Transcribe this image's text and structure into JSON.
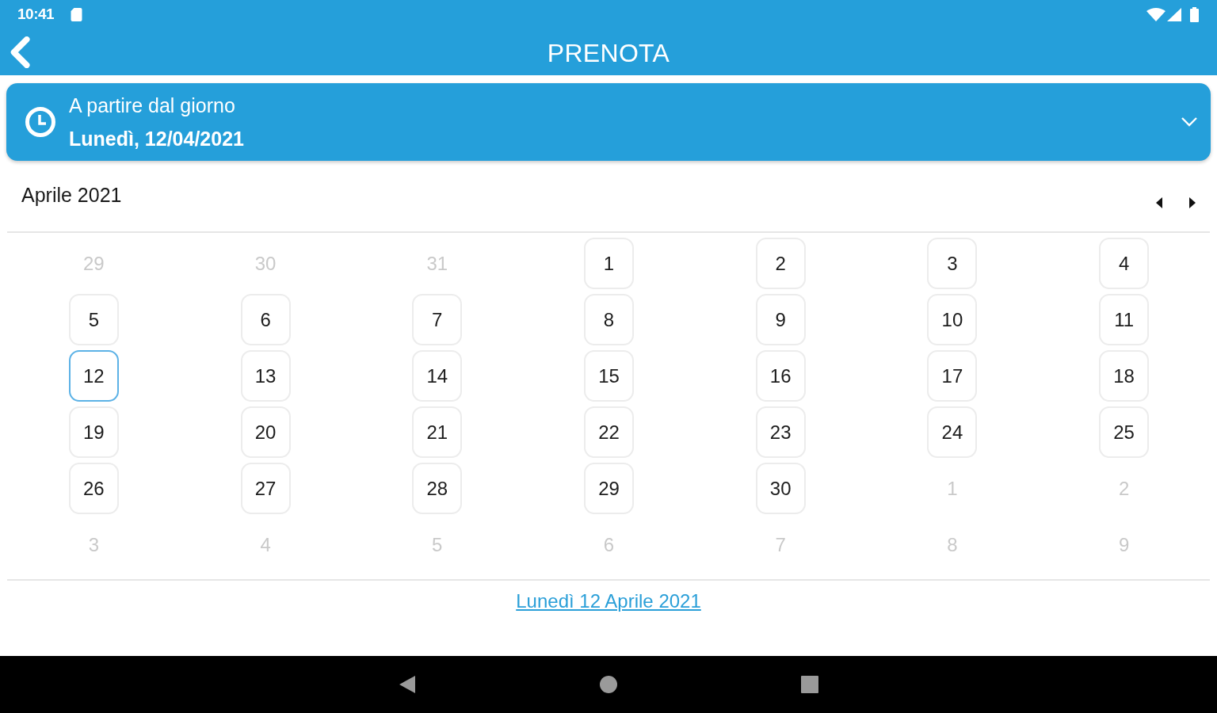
{
  "status_bar": {
    "time": "10:41"
  },
  "app_bar": {
    "title": "PRENOTA"
  },
  "date_picker": {
    "label": "A partire dal giorno",
    "value": "Lunedì, 12/04/2021",
    "expanded": false
  },
  "calendar": {
    "month": "Aprile 2021",
    "days": [
      {
        "label": "29",
        "outside_month": true,
        "selected": false
      },
      {
        "label": "30",
        "outside_month": true,
        "selected": false
      },
      {
        "label": "31",
        "outside_month": true,
        "selected": false
      },
      {
        "label": "1",
        "outside_month": false,
        "selected": false
      },
      {
        "label": "2",
        "outside_month": false,
        "selected": false
      },
      {
        "label": "3",
        "outside_month": false,
        "selected": false
      },
      {
        "label": "4",
        "outside_month": false,
        "selected": false
      },
      {
        "label": "5",
        "outside_month": false,
        "selected": false
      },
      {
        "label": "6",
        "outside_month": false,
        "selected": false
      },
      {
        "label": "7",
        "outside_month": false,
        "selected": false
      },
      {
        "label": "8",
        "outside_month": false,
        "selected": false
      },
      {
        "label": "9",
        "outside_month": false,
        "selected": false
      },
      {
        "label": "10",
        "outside_month": false,
        "selected": false
      },
      {
        "label": "11",
        "outside_month": false,
        "selected": false
      },
      {
        "label": "12",
        "outside_month": false,
        "selected": true
      },
      {
        "label": "13",
        "outside_month": false,
        "selected": false
      },
      {
        "label": "14",
        "outside_month": false,
        "selected": false
      },
      {
        "label": "15",
        "outside_month": false,
        "selected": false
      },
      {
        "label": "16",
        "outside_month": false,
        "selected": false
      },
      {
        "label": "17",
        "outside_month": false,
        "selected": false
      },
      {
        "label": "18",
        "outside_month": false,
        "selected": false
      },
      {
        "label": "19",
        "outside_month": false,
        "selected": false
      },
      {
        "label": "20",
        "outside_month": false,
        "selected": false
      },
      {
        "label": "21",
        "outside_month": false,
        "selected": false
      },
      {
        "label": "22",
        "outside_month": false,
        "selected": false
      },
      {
        "label": "23",
        "outside_month": false,
        "selected": false
      },
      {
        "label": "24",
        "outside_month": false,
        "selected": false
      },
      {
        "label": "25",
        "outside_month": false,
        "selected": false
      },
      {
        "label": "26",
        "outside_month": false,
        "selected": false
      },
      {
        "label": "27",
        "outside_month": false,
        "selected": false
      },
      {
        "label": "28",
        "outside_month": false,
        "selected": false
      },
      {
        "label": "29",
        "outside_month": false,
        "selected": false
      },
      {
        "label": "30",
        "outside_month": false,
        "selected": false
      },
      {
        "label": "1",
        "outside_month": true,
        "selected": false
      },
      {
        "label": "2",
        "outside_month": true,
        "selected": false
      },
      {
        "label": "3",
        "outside_month": true,
        "selected": false
      },
      {
        "label": "4",
        "outside_month": true,
        "selected": false
      },
      {
        "label": "5",
        "outside_month": true,
        "selected": false
      },
      {
        "label": "6",
        "outside_month": true,
        "selected": false
      },
      {
        "label": "7",
        "outside_month": true,
        "selected": false
      },
      {
        "label": "8",
        "outside_month": true,
        "selected": false
      },
      {
        "label": "9",
        "outside_month": true,
        "selected": false
      }
    ],
    "selected_date_link": "Lunedì 12 Aprile 2021"
  }
}
